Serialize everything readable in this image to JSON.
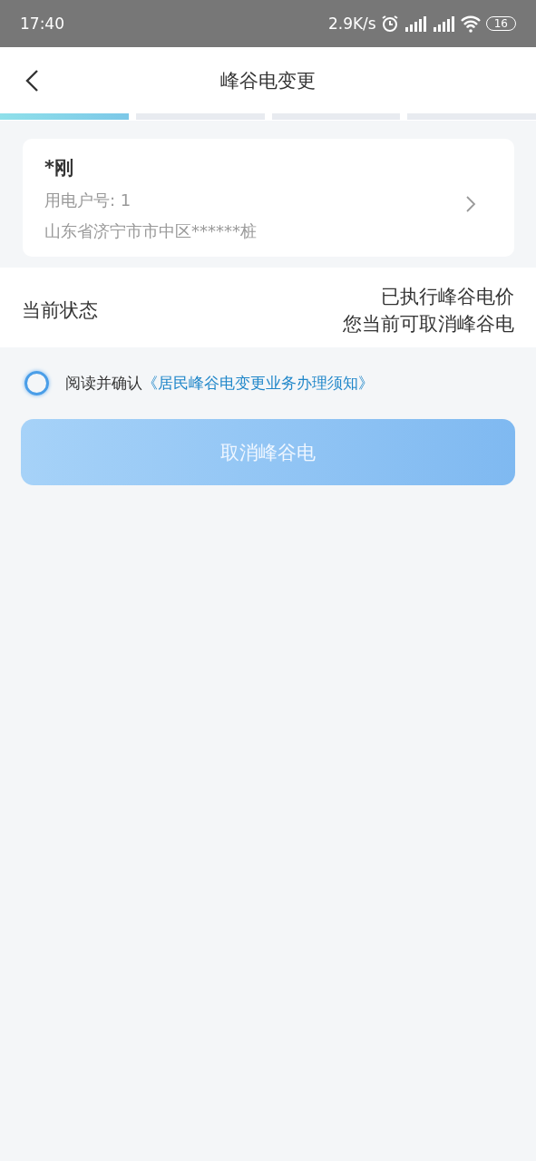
{
  "status_bar": {
    "time": "17:40",
    "speed": "2.9K/s",
    "battery": "16"
  },
  "nav": {
    "title": "峰谷电变更"
  },
  "steps": [
    {
      "active": true
    },
    {
      "active": false
    },
    {
      "active": false
    },
    {
      "active": false
    }
  ],
  "account": {
    "name": "*刚",
    "number": "用电户号: 1",
    "address": "山东省济宁市市中区******桩"
  },
  "status": {
    "label": "当前状态",
    "lines": [
      "已执行峰谷电价",
      "您当前可取消峰谷电"
    ]
  },
  "agreement": {
    "checked": false,
    "prefix": "阅读并确认",
    "link": "《居民峰谷电变更业务办理须知》"
  },
  "action": {
    "label": "取消峰谷电",
    "disabled": true
  }
}
